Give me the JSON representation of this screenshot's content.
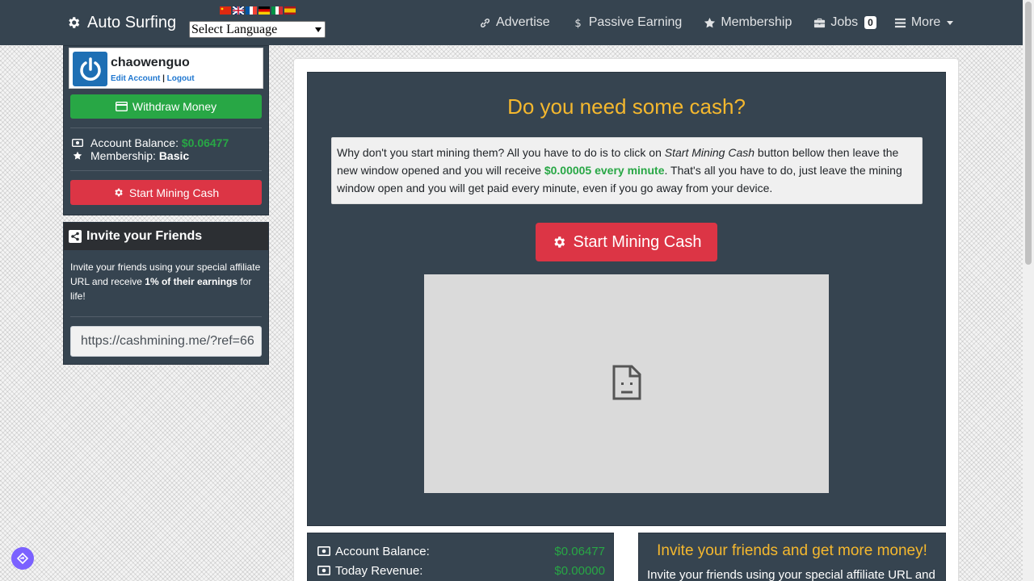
{
  "navbar": {
    "brand": "Auto Surfing",
    "language_select": "Select Language",
    "links": {
      "advertise": "Advertise",
      "passive_earning": "Passive Earning",
      "membership": "Membership",
      "jobs": "Jobs",
      "jobs_badge": "0",
      "more": "More"
    },
    "flags": [
      "china-flag",
      "uk-flag",
      "france-flag",
      "germany-flag",
      "italy-flag",
      "spain-flag"
    ]
  },
  "sidebar": {
    "username": "chaowenguo",
    "edit_account": "Edit Account",
    "separator": "|",
    "logout": "Logout",
    "withdraw_button": "Withdraw Money",
    "balance_label": "Account Balance:",
    "balance_value": "$0.06477",
    "membership_label": "Membership:",
    "membership_value": "Basic",
    "mining_button": "Start Mining Cash"
  },
  "invite": {
    "title": "Invite your Friends",
    "text_before": "Invite your friends using your special affiliate URL and receive ",
    "text_bold": "1% of their earnings",
    "text_after": " for life!",
    "ref_url": "https://cashmining.me/?ref=66"
  },
  "main": {
    "title": "Do you need some cash?",
    "info_part1": "Why don't you start mining them? All you have to do is to click on ",
    "info_em": "Start Mining Cash",
    "info_part2": " button bellow then leave the new window opened and you will receive ",
    "info_rate": "$0.00005 every minute",
    "info_part3": ". That's all you have to do, just leave the mining window open and you will get paid every minute, even if you go away from your device.",
    "mining_button": "Start Mining Cash"
  },
  "stats": {
    "balance_label": "Account Balance:",
    "balance_value": "$0.06477",
    "revenue_label": "Today Revenue:",
    "revenue_value": "$0.00000"
  },
  "friends": {
    "title": "Invite your friends and get more money!",
    "text": "Invite your friends using your special affiliate URL and"
  },
  "colors": {
    "navbar": "#364450",
    "accent_yellow": "#f5b82e",
    "green": "#28a745",
    "red": "#dc3545",
    "link_blue": "#1f77d0"
  }
}
